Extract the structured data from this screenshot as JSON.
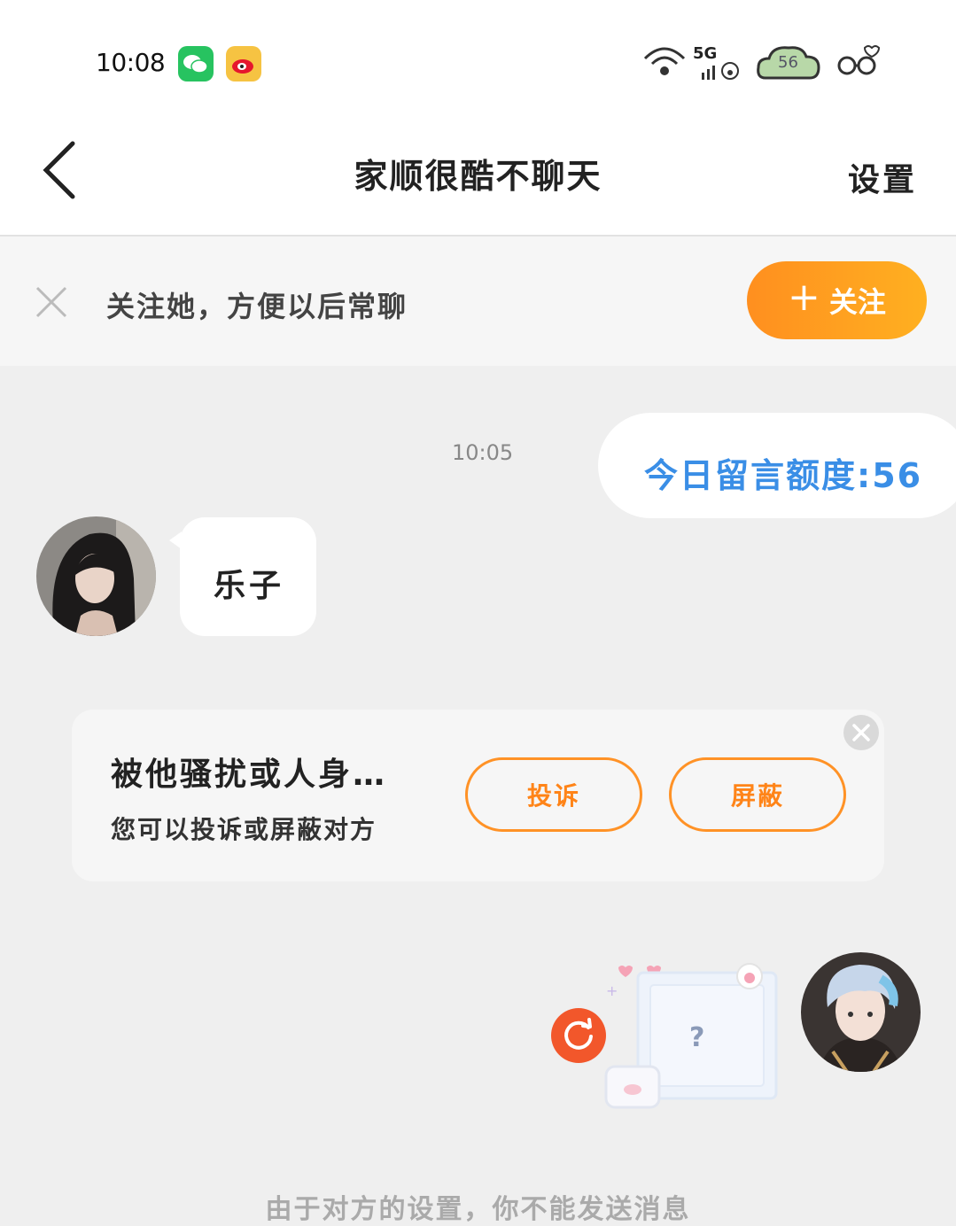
{
  "status_bar": {
    "time": "10:08",
    "network": "5G",
    "battery": "56",
    "icons": [
      "wechat-icon",
      "weibo-icon",
      "wifi-icon",
      "signal-icon",
      "battery-icon",
      "glasses-icon"
    ]
  },
  "nav": {
    "title": "家顺很酷不聊天",
    "settings_label": "设置"
  },
  "follow_bar": {
    "text": "关注她，方便以后常聊",
    "button_label": "关注",
    "button_icon": "plus-icon"
  },
  "chat": {
    "timestamp": "10:05",
    "quota_text": "今日留言额度:56",
    "incoming_message": "乐子"
  },
  "report_card": {
    "title": "被他骚扰或人身…",
    "subtitle": "您可以投诉或屏蔽对方",
    "report_label": "投诉",
    "block_label": "屏蔽"
  },
  "outgoing_image": {
    "placeholder": "?"
  },
  "footer": {
    "text": "由于对方的设置，你不能发送消息"
  },
  "colors": {
    "accent_orange": "#ff9226",
    "quota_blue": "#3a8ee6",
    "retry_red": "#f2572b"
  }
}
